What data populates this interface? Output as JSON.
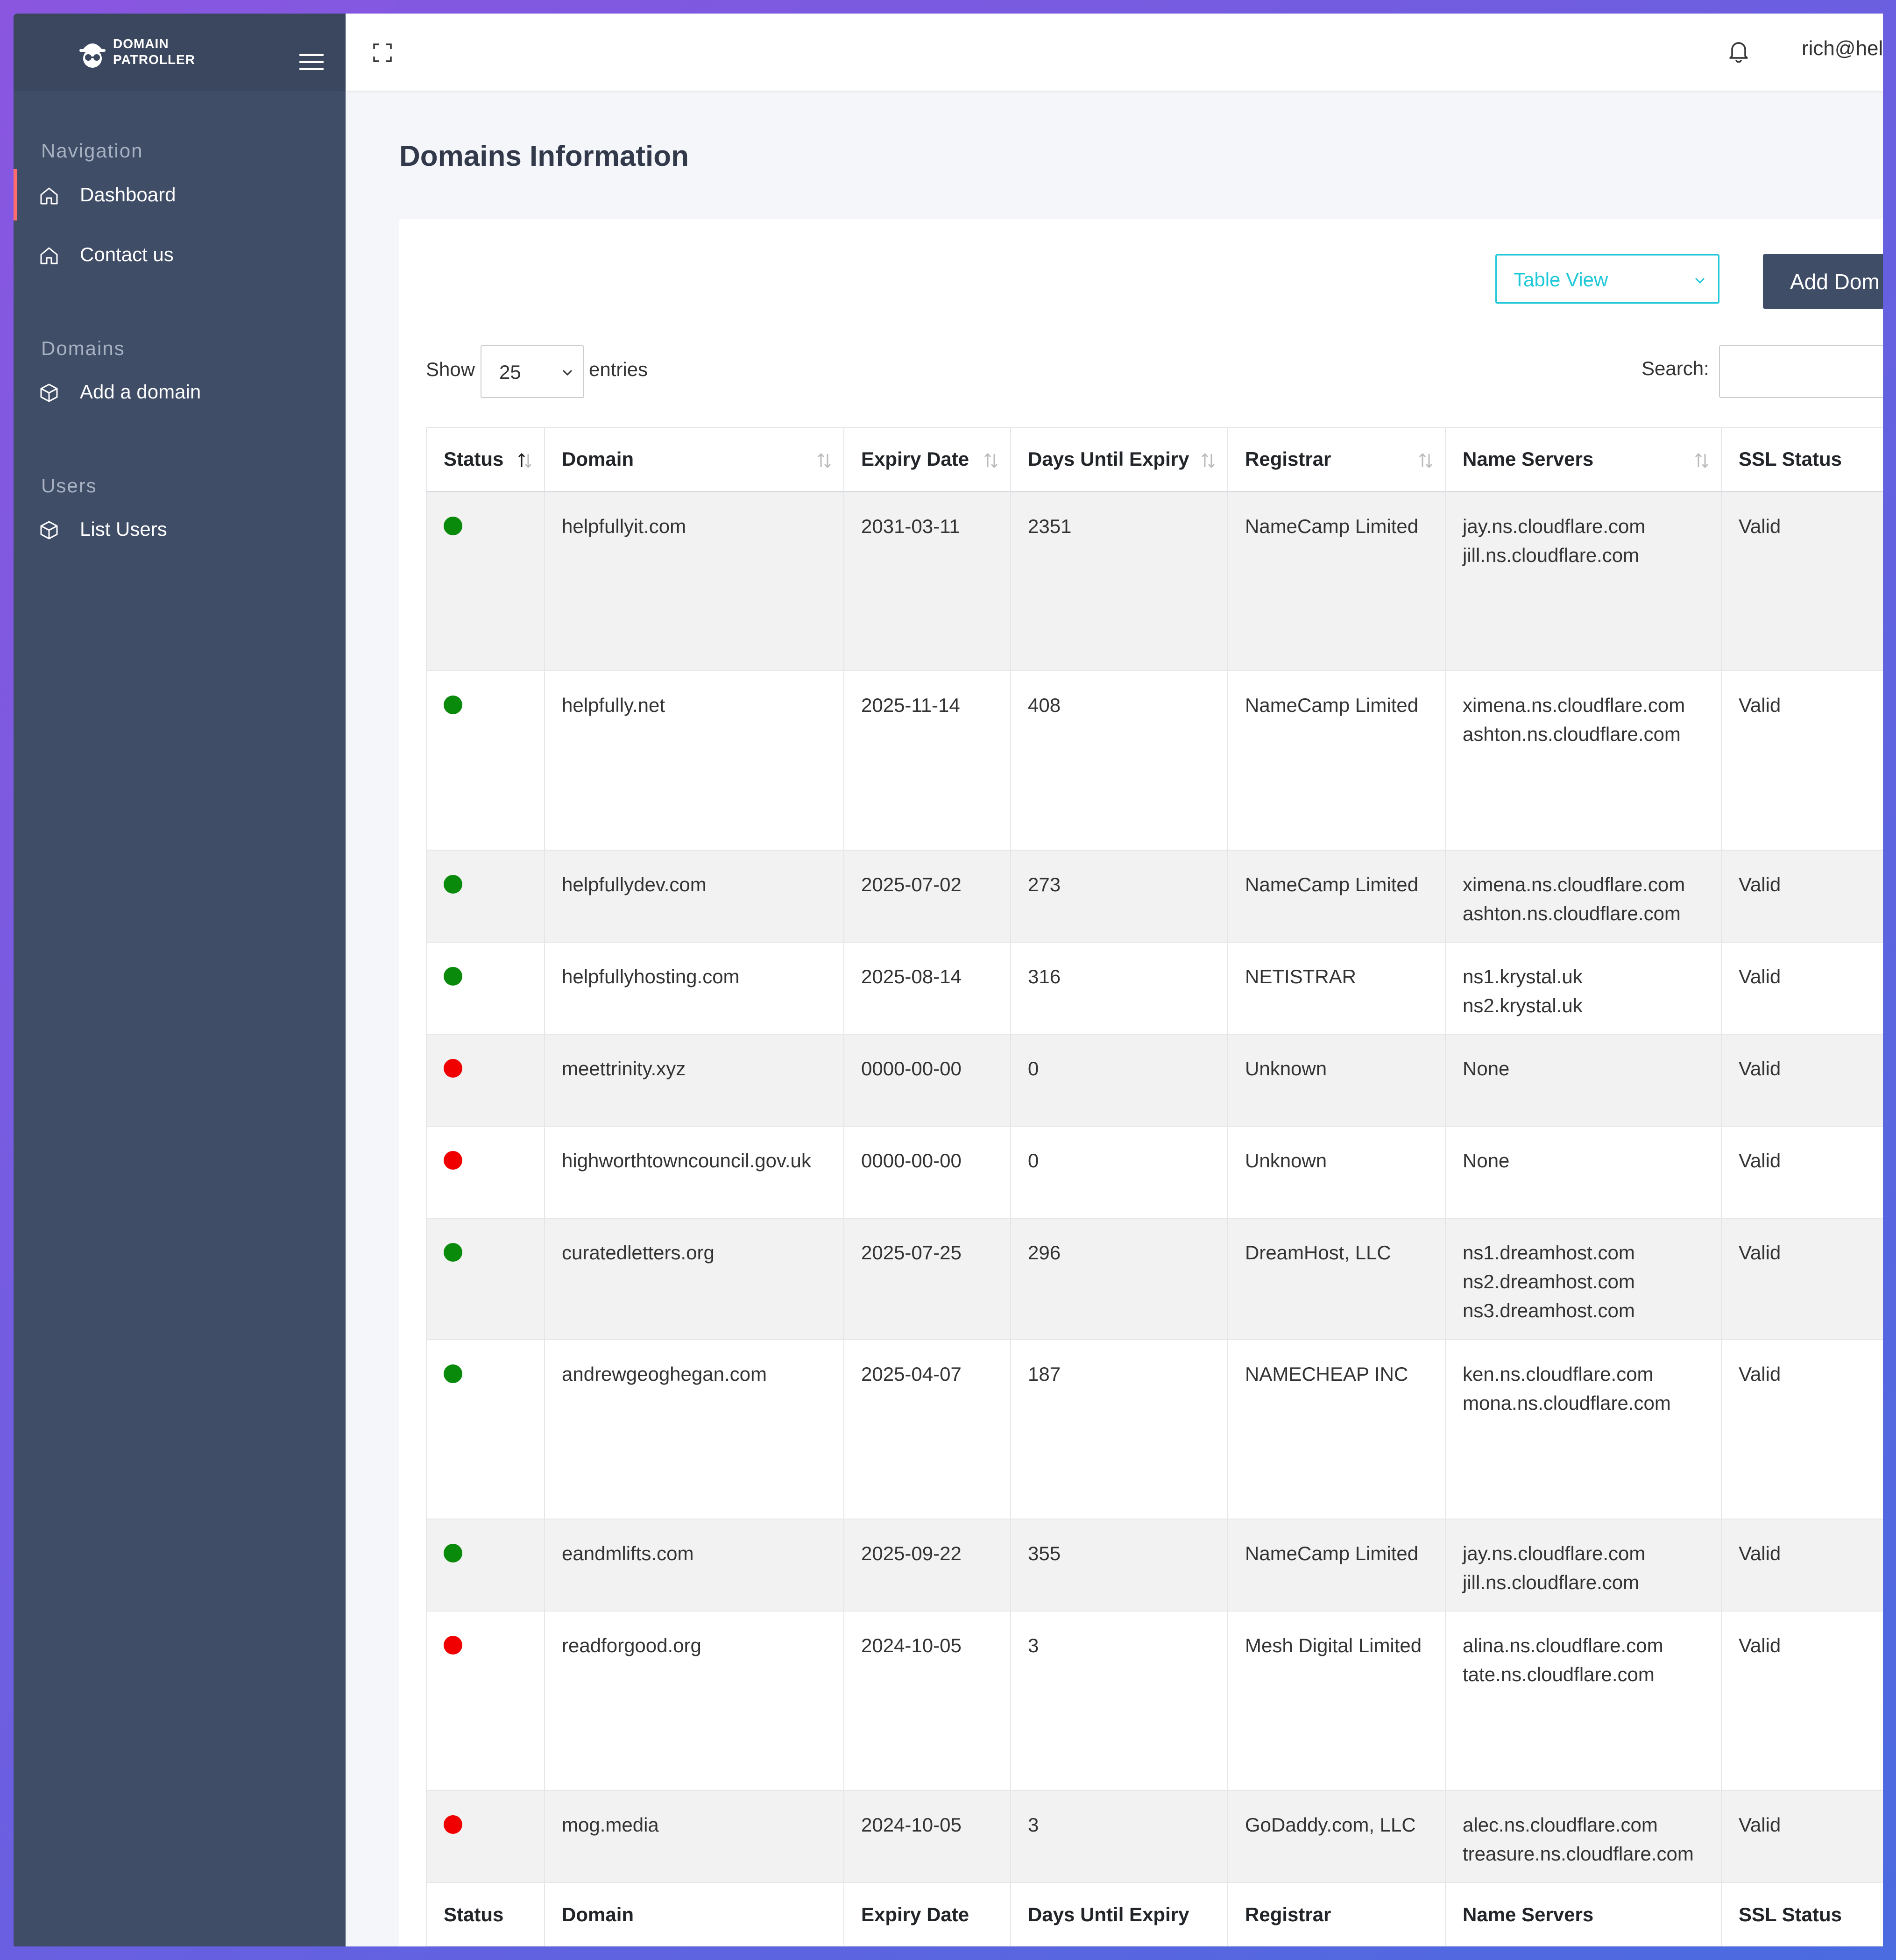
{
  "brand": {
    "line1": "DOMAIN",
    "line2": "PATROLLER"
  },
  "sidebar": {
    "sections": [
      {
        "caption": "Navigation",
        "items": [
          {
            "label": "Dashboard",
            "icon": "home-icon"
          },
          {
            "label": "Contact us",
            "icon": "home-icon"
          }
        ]
      },
      {
        "caption": "Domains",
        "items": [
          {
            "label": "Add a domain",
            "icon": "box-icon"
          }
        ]
      },
      {
        "caption": "Users",
        "items": [
          {
            "label": "List Users",
            "icon": "box-icon"
          }
        ]
      }
    ]
  },
  "topbar": {
    "user_email": "rich@hel"
  },
  "page": {
    "title": "Domains Information"
  },
  "toolbar": {
    "view_select": "Table View",
    "add_domain_label": "Add Dom"
  },
  "table_controls": {
    "show_label": "Show",
    "entries_value": "25",
    "entries_label": "entries",
    "search_label": "Search:",
    "search_value": ""
  },
  "columns": [
    "Status",
    "Domain",
    "Expiry Date",
    "Days Until Expiry",
    "Registrar",
    "Name Servers",
    "SSL Status"
  ],
  "rows": [
    {
      "status": "ok",
      "domain": "helpfullyit.com",
      "expiry": "2031-03-11",
      "days": "2351",
      "registrar": "NameCamp Limited",
      "ns": [
        "jay.ns.cloudflare.com",
        "jill.ns.cloudflare.com"
      ],
      "ssl": "Valid"
    },
    {
      "status": "ok",
      "domain": "helpfully.net",
      "expiry": "2025-11-14",
      "days": "408",
      "registrar": "NameCamp Limited",
      "ns": [
        "ximena.ns.cloudflare.com",
        "ashton.ns.cloudflare.com"
      ],
      "ssl": "Valid"
    },
    {
      "status": "ok",
      "domain": "helpfullydev.com",
      "expiry": "2025-07-02",
      "days": "273",
      "registrar": "NameCamp Limited",
      "ns": [
        "ximena.ns.cloudflare.com",
        "ashton.ns.cloudflare.com"
      ],
      "ssl": "Valid"
    },
    {
      "status": "ok",
      "domain": "helpfullyhosting.com",
      "expiry": "2025-08-14",
      "days": "316",
      "registrar": "NETISTRAR",
      "ns": [
        "ns1.krystal.uk",
        "ns2.krystal.uk"
      ],
      "ssl": "Valid"
    },
    {
      "status": "bad",
      "domain": "meettrinity.xyz",
      "expiry": "0000-00-00",
      "days": "0",
      "registrar": "Unknown",
      "ns": [
        "None"
      ],
      "ssl": "Valid"
    },
    {
      "status": "bad",
      "domain": "highworthtowncouncil.gov.uk",
      "expiry": "0000-00-00",
      "days": "0",
      "registrar": "Unknown",
      "ns": [
        "None"
      ],
      "ssl": "Valid"
    },
    {
      "status": "ok",
      "domain": "curatedletters.org",
      "expiry": "2025-07-25",
      "days": "296",
      "registrar": "DreamHost, LLC",
      "ns": [
        "ns1.dreamhost.com",
        "ns2.dreamhost.com",
        "ns3.dreamhost.com"
      ],
      "ssl": "Valid"
    },
    {
      "status": "ok",
      "domain": "andrewgeoghegan.com",
      "expiry": "2025-04-07",
      "days": "187",
      "registrar": "NAMECHEAP INC",
      "ns": [
        "ken.ns.cloudflare.com",
        "mona.ns.cloudflare.com"
      ],
      "ssl": "Valid"
    },
    {
      "status": "ok",
      "domain": "eandmlifts.com",
      "expiry": "2025-09-22",
      "days": "355",
      "registrar": "NameCamp Limited",
      "ns": [
        "jay.ns.cloudflare.com",
        "jill.ns.cloudflare.com"
      ],
      "ssl": "Valid"
    },
    {
      "status": "bad",
      "domain": "readforgood.org",
      "expiry": "2024-10-05",
      "days": "3",
      "registrar": "Mesh Digital Limited",
      "ns": [
        "alina.ns.cloudflare.com",
        "tate.ns.cloudflare.com"
      ],
      "ssl": "Valid"
    },
    {
      "status": "bad",
      "domain": "mog.media",
      "expiry": "2024-10-05",
      "days": "3",
      "registrar": "GoDaddy.com, LLC",
      "ns": [
        "alec.ns.cloudflare.com",
        "treasure.ns.cloudflare.com"
      ],
      "ssl": "Valid"
    }
  ],
  "colors": {
    "sidebar": "#3f4d67",
    "active_marker": "#ff6c6c",
    "accent": "#1ec8d8",
    "status_ok": "#0a8a0a",
    "status_bad": "#f00000"
  }
}
